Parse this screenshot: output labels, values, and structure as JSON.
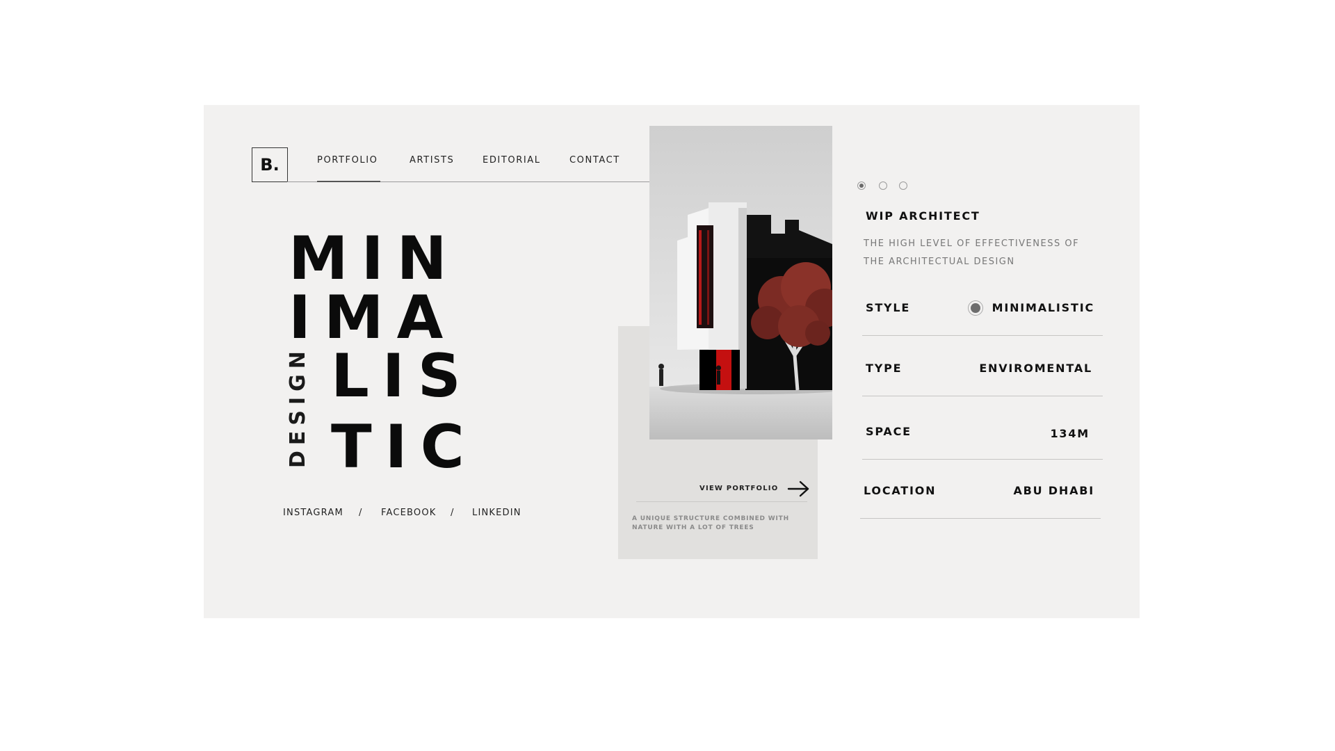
{
  "brand": {
    "logo": "B."
  },
  "nav": {
    "items": [
      {
        "label": "PORTFOLIO",
        "active": true
      },
      {
        "label": "ARTISTS"
      },
      {
        "label": "EDITORIAL"
      },
      {
        "label": "CONTACT"
      }
    ]
  },
  "hero": {
    "lines": [
      "MIN",
      "IMA",
      "LIS",
      "TIC"
    ],
    "vertical_word": "DESIGN"
  },
  "social": {
    "links": [
      "INSTAGRAM",
      "FACEBOOK",
      "LINKEDIN"
    ],
    "separator": "/"
  },
  "feature": {
    "image_alt": "Minimalist white and black building with a red-leaved tree",
    "cta_label": "VIEW PORTFOLIO",
    "caption": "A UNIQUE STRUCTURE COMBINED WITH NATURE WITH A LOT OF TREES"
  },
  "carousel": {
    "count": 3,
    "active_index": 0
  },
  "project": {
    "title": "WIP ARCHITECT",
    "description": "THE HIGH LEVEL OF EFFECTIVENESS OF THE ARCHITECTUAL DESIGN",
    "specs": [
      {
        "label": "STYLE",
        "value": "MINIMALISTIC",
        "icon": "radio-filled-icon"
      },
      {
        "label": "TYPE",
        "value": "ENVIROMENTAL"
      },
      {
        "label": "SPACE",
        "value": "134M"
      },
      {
        "label": "LOCATION",
        "value": "ABU DHABI"
      }
    ]
  },
  "colors": {
    "background": "#ffffff",
    "card": "#f2f1f0",
    "panel": "#e1e0de",
    "text": "#111111",
    "muted": "#777777",
    "accent_red": "#c8102e"
  }
}
